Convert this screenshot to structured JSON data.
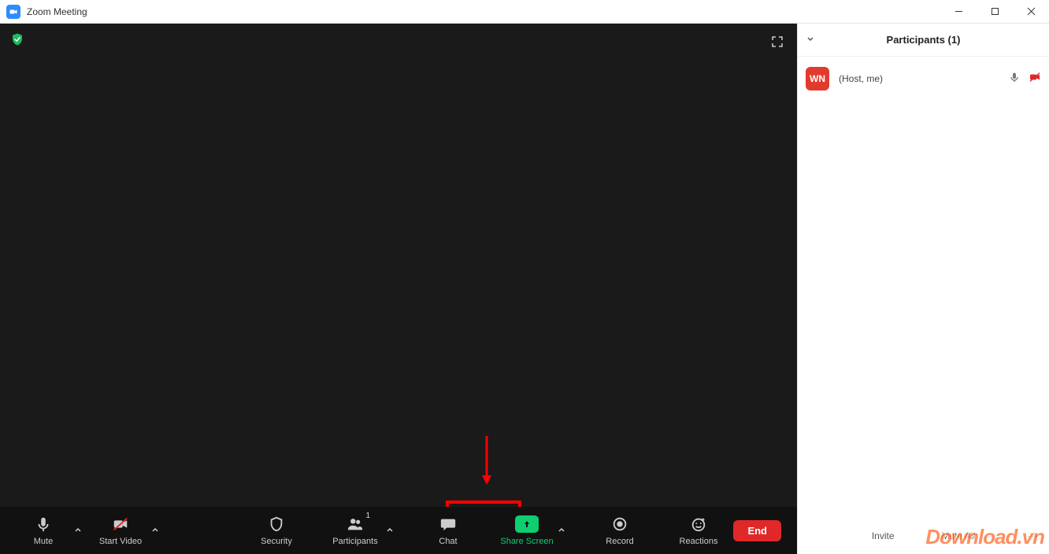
{
  "window": {
    "title": "Zoom Meeting"
  },
  "toolbar": {
    "mute": "Mute",
    "start_video": "Start Video",
    "security": "Security",
    "participants": "Participants",
    "participants_count": "1",
    "chat": "Chat",
    "share_screen": "Share Screen",
    "record": "Record",
    "reactions": "Reactions",
    "end": "End"
  },
  "panel": {
    "title": "Participants (1)",
    "items": [
      {
        "initials": "WN",
        "role": "(Host, me)"
      }
    ],
    "footer": {
      "invite": "Invite",
      "mute_all": "Mute All"
    }
  },
  "watermark": "Download.vn",
  "colors": {
    "accent_green": "#0fce6f",
    "accent_red": "#e02828",
    "avatar_red": "#e23b2e",
    "highlight": "#ff0000"
  }
}
